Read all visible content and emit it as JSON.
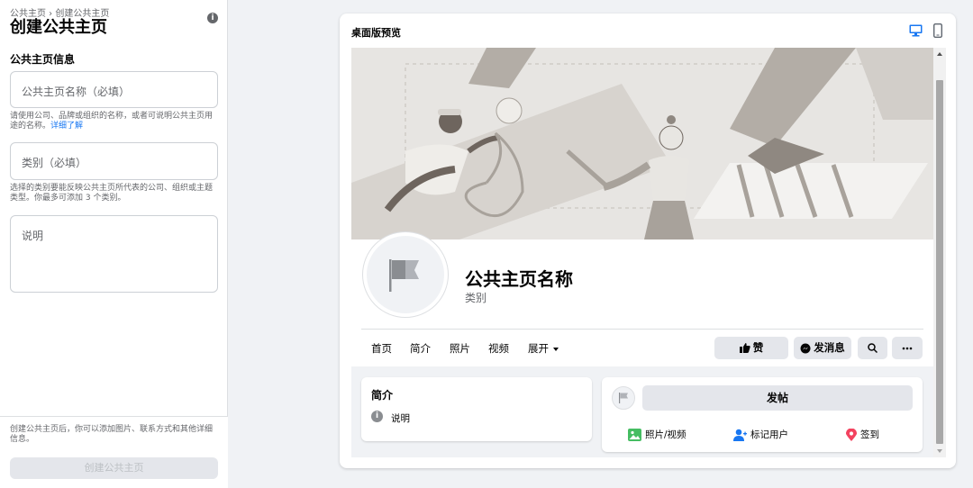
{
  "left": {
    "breadcrumb": "公共主页 › 创建公共主页",
    "title": "创建公共主页",
    "section_title": "公共主页信息",
    "name_placeholder": "公共主页名称（必填）",
    "name_hint": "请使用公司、品牌或组织的名称，或者可说明公共主页用途的名称。",
    "name_hint_link": "详细了解",
    "category_placeholder": "类别（必填）",
    "category_hint": "选择的类别要能反映公共主页所代表的公司、组织或主题类型。你最多可添加 3 个类别。",
    "description_placeholder": "说明",
    "footer_note": "创建公共主页后，你可以添加图片、联系方式和其他详细信息。",
    "create_button": "创建公共主页"
  },
  "preview": {
    "title": "桌面版预览",
    "page_name": "公共主页名称",
    "page_category": "类别",
    "tabs": [
      "首页",
      "简介",
      "照片",
      "视频",
      "展开"
    ],
    "actions": {
      "like": "赞",
      "message": "发消息"
    },
    "intro": {
      "title": "简介",
      "description": "说明"
    },
    "post": {
      "button": "发帖",
      "photo_video": "照片/视频",
      "tag_people": "标记用户",
      "check_in": "签到"
    }
  },
  "colors": {
    "accent": "#1877f2",
    "button_bg": "#e4e6eb",
    "photo_icon": "#45bd62",
    "tag_icon": "#1877f2",
    "checkin_icon": "#f3425f",
    "cover_bg": "#e7e5e2"
  },
  "icons": [
    "info-icon",
    "desktop-icon",
    "mobile-icon",
    "flag-icon",
    "like-icon",
    "messenger-icon",
    "search-icon",
    "more-icon",
    "photo-icon",
    "tag-user-icon",
    "location-pin-icon"
  ]
}
